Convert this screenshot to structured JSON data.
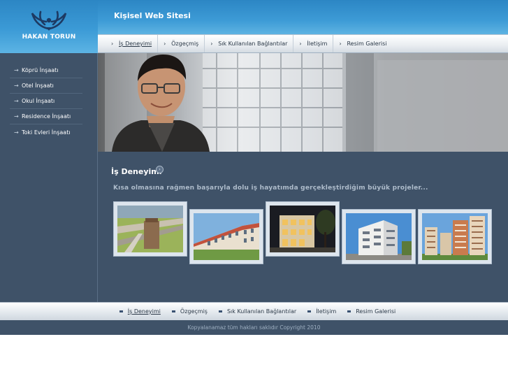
{
  "brand": {
    "name": "HAKAN TORUN",
    "logo_icon": "eagle-emblem-icon"
  },
  "header": {
    "title": "Kişisel Web Sitesi"
  },
  "top_nav": {
    "items": [
      {
        "label": "İş Deneyimi",
        "active": true
      },
      {
        "label": "Özgeçmiş",
        "active": false
      },
      {
        "label": "Sık Kullanılan Bağlantılar",
        "active": false
      },
      {
        "label": "İletişim",
        "active": false
      },
      {
        "label": "Resim Galerisi",
        "active": false
      }
    ]
  },
  "sidebar": {
    "items": [
      {
        "label": "Köprü İnşaatı"
      },
      {
        "label": "Otel İnşaatı"
      },
      {
        "label": "Okul İnşaatı"
      },
      {
        "label": "Residence İnşaatı"
      },
      {
        "label": "Toki Evleri İnşaatı"
      }
    ]
  },
  "main": {
    "section_title": "İş Deneyimi",
    "lead": "Kısa olmasına rağmen başarıyla dolu iş hayatımda gerçekleştirdiğim büyük projeler...",
    "gallery_icons": [
      "bridge-photo",
      "school-photo",
      "hotel-photo",
      "residence-photo",
      "toki-buildings-photo"
    ]
  },
  "footer_nav": {
    "items": [
      {
        "label": "İş Deneyimi",
        "active": true
      },
      {
        "label": "Özgeçmiş",
        "active": false
      },
      {
        "label": "Sık Kullanılan Bağlantılar",
        "active": false
      },
      {
        "label": "İletişim",
        "active": false
      },
      {
        "label": "Resim Galerisi",
        "active": false
      }
    ]
  },
  "footer": {
    "copyright": "Kopyalanamaz tüm hakları saklıdır Copyright 2010"
  },
  "colors": {
    "header_blue": "#2c86c4",
    "panel_navy": "#3f5268",
    "lead_text": "#aebccb"
  }
}
